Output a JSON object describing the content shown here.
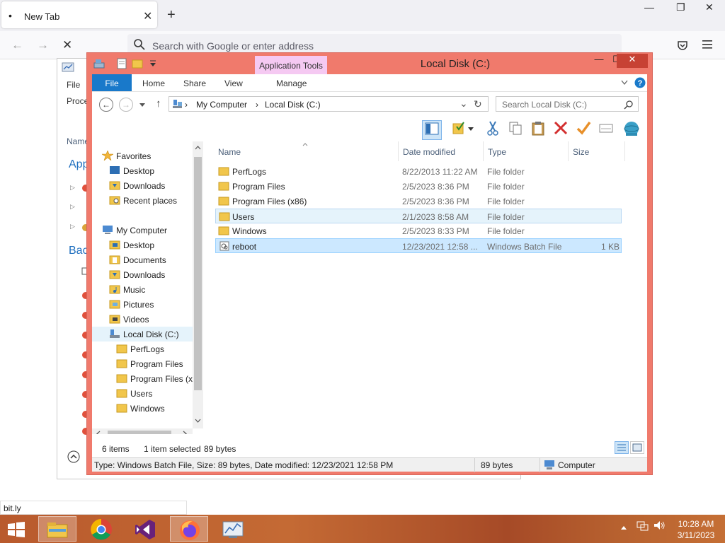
{
  "browser": {
    "tab_title": "New Tab",
    "tab_dot": "•",
    "tab_close": "✕",
    "new_tab": "+",
    "minimize": "—",
    "restore": "❐",
    "close": "✕",
    "back": "←",
    "forward": "→",
    "stop": "✕",
    "address_placeholder": "Search with Google or enter address",
    "status_url": "bit.ly"
  },
  "background_window": {
    "menu_file": "File",
    "tab_proce": "Proce",
    "col_name": "Name",
    "section_app": "App",
    "section_bac": "Bac"
  },
  "explorer": {
    "title": "Local Disk (C:)",
    "contextual_tab": "Application Tools",
    "ribbon_tabs": {
      "file": "File",
      "home": "Home",
      "share": "Share",
      "view": "View",
      "manage": "Manage"
    },
    "minimize": "—",
    "maximize": "☐",
    "close": "✕",
    "address": {
      "back": "←",
      "forward": "→",
      "crumb1": "My Computer",
      "crumb2": "Local Disk (C:)",
      "sep": "›",
      "recent": "⌄",
      "up": "↑",
      "refresh": "↻"
    },
    "search_placeholder": "Search Local Disk (C:)",
    "nav": {
      "favorites": "Favorites",
      "fav_desktop": "Desktop",
      "fav_downloads": "Downloads",
      "fav_recent": "Recent places",
      "my_computer": "My Computer",
      "pc_desktop": "Desktop",
      "pc_documents": "Documents",
      "pc_downloads": "Downloads",
      "pc_music": "Music",
      "pc_pictures": "Pictures",
      "pc_videos": "Videos",
      "local_disk": "Local Disk (C:)",
      "perflogs": "PerfLogs",
      "program_files": "Program Files",
      "program_files_x86": "Program Files (x8",
      "users": "Users",
      "windows": "Windows"
    },
    "columns": {
      "name": "Name",
      "date_modified": "Date modified",
      "type": "Type",
      "size": "Size"
    },
    "files": [
      {
        "name": "PerfLogs",
        "date": "8/22/2013 11:22 AM",
        "type": "File folder",
        "size": ""
      },
      {
        "name": "Program Files",
        "date": "2/5/2023 8:36 PM",
        "type": "File folder",
        "size": ""
      },
      {
        "name": "Program Files (x86)",
        "date": "2/5/2023 8:36 PM",
        "type": "File folder",
        "size": ""
      },
      {
        "name": "Users",
        "date": "2/1/2023 8:58 AM",
        "type": "File folder",
        "size": ""
      },
      {
        "name": "Windows",
        "date": "2/5/2023 8:33 PM",
        "type": "File folder",
        "size": ""
      },
      {
        "name": "reboot",
        "date": "12/23/2021 12:58 ...",
        "type": "Windows Batch File",
        "size": "1 KB"
      }
    ],
    "status": {
      "items": "6 items",
      "selected": "1 item selected",
      "bytes": "89 bytes"
    },
    "details": {
      "text": "Type: Windows Batch File, Size: 89 bytes, Date modified: 12/23/2021 12:58 PM",
      "size": "89 bytes",
      "location": "Computer"
    }
  },
  "taskbar": {
    "time": "10:28 AM",
    "date": "3/11/2023"
  },
  "colors": {
    "explorer_frame": "#f07a6c",
    "ribbon_file": "#1979ca",
    "selection": "#cce8ff",
    "taskbar": "#b95a2d"
  }
}
